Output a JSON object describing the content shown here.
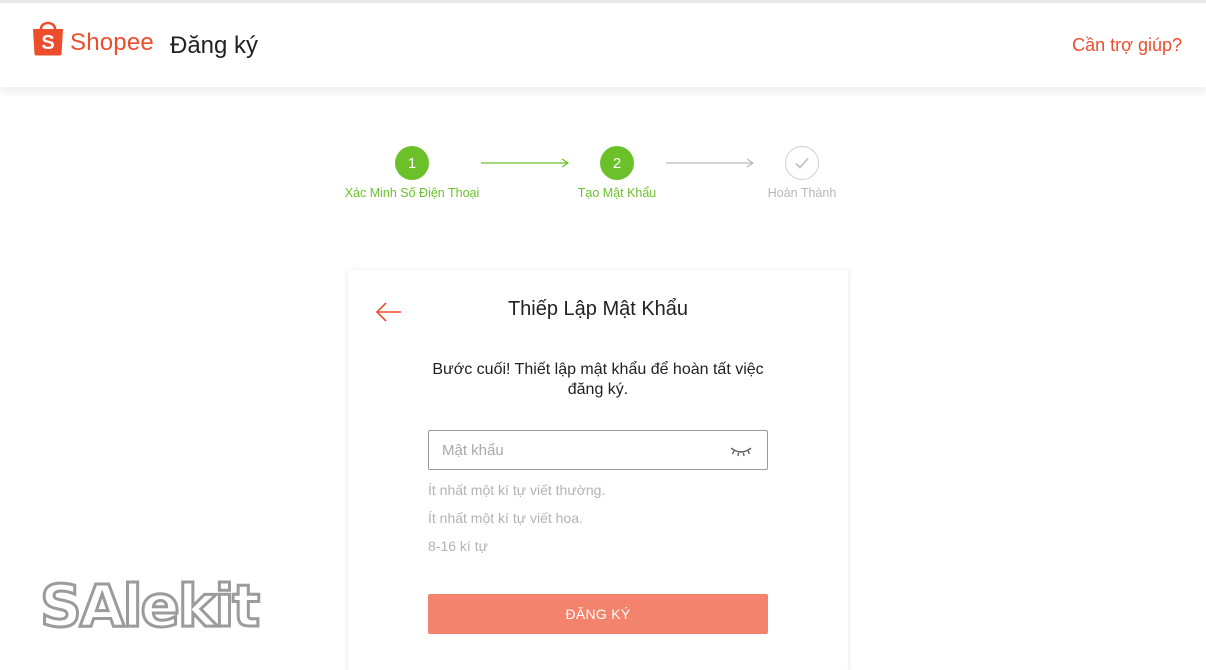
{
  "header": {
    "logo_text": "Shopee",
    "logo_icon": "shopping-bag-icon",
    "page_title": "Đăng ký",
    "help_link": "Cần trợ giúp?"
  },
  "stepper": {
    "steps": [
      {
        "number": "1",
        "label": "Xác Minh Số Điện Thoại",
        "status": "completed"
      },
      {
        "number": "2",
        "label": "Tạo Mật Khẩu",
        "status": "current"
      },
      {
        "number": "",
        "label": "Hoàn Thành",
        "status": "pending",
        "icon": "checkmark-icon"
      }
    ]
  },
  "card": {
    "title": "Thiếp Lập Mật Khẩu",
    "back_icon": "arrow-left-icon",
    "description": "Bước cuối! Thiết lập mật khẩu để hoàn tất việc đăng ký.",
    "password_field": {
      "placeholder": "Mật khẩu",
      "value": "",
      "toggle_icon": "eye-closed-icon"
    },
    "rules": [
      "Ít nhất một kí tự viết thường.",
      "Ít nhất một kí tự viết hoa.",
      "8-16 kí tự"
    ],
    "submit_label": "ĐĂNG KÝ"
  },
  "watermark": {
    "text": "SAlekit"
  },
  "colors": {
    "brand": "#ee4d2d",
    "step_active": "#6cc12a",
    "step_inactive": "#b7b7b7",
    "button_disabled": "#f3836d",
    "hint_text": "#b3b3b3"
  }
}
